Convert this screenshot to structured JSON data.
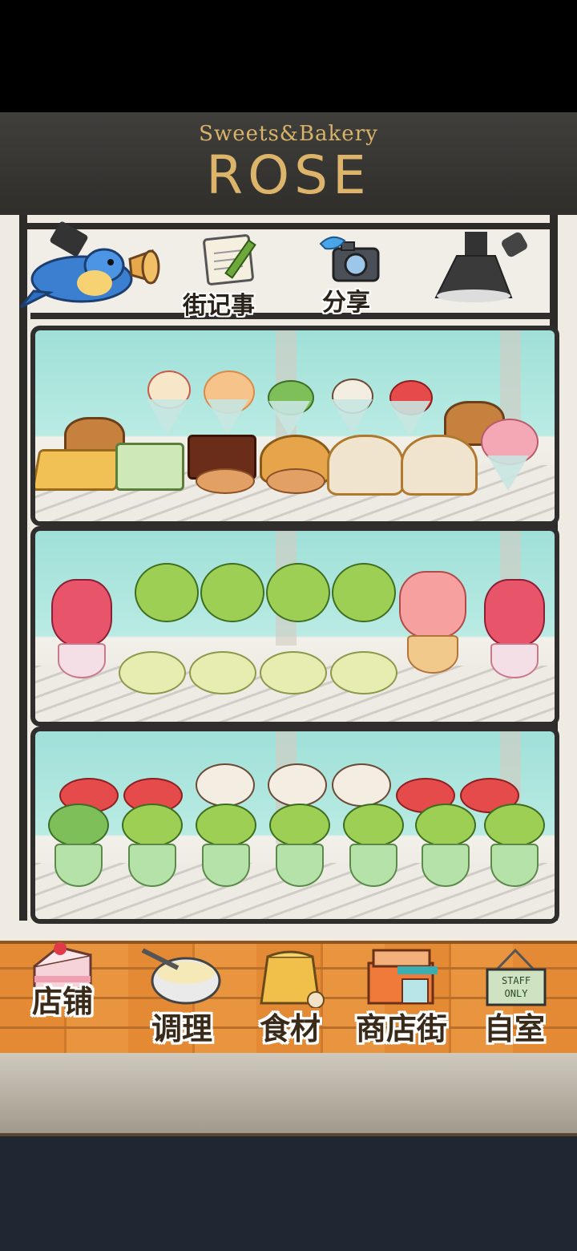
{
  "sign": {
    "subtitle": "Sweets&Bakery",
    "title": "ROSE"
  },
  "top_shelf": {
    "news_label": "街记事",
    "share_label": "分享"
  },
  "nav": {
    "items": [
      {
        "label": "店铺",
        "icon": "cake-icon"
      },
      {
        "label": "调理",
        "icon": "mixing-bowl-icon"
      },
      {
        "label": "食材",
        "icon": "flour-bag-icon"
      },
      {
        "label": "商店街",
        "icon": "shop-icon"
      },
      {
        "label": "自室",
        "icon": "staff-only-sign-icon"
      }
    ]
  },
  "staff_sign_text": "STAFF ONLY",
  "colors": {
    "sign_bg": "#3a3937",
    "sign_text": "#dcb56b",
    "brick": "#e48a35",
    "bottom_bar": "#1f2733"
  }
}
